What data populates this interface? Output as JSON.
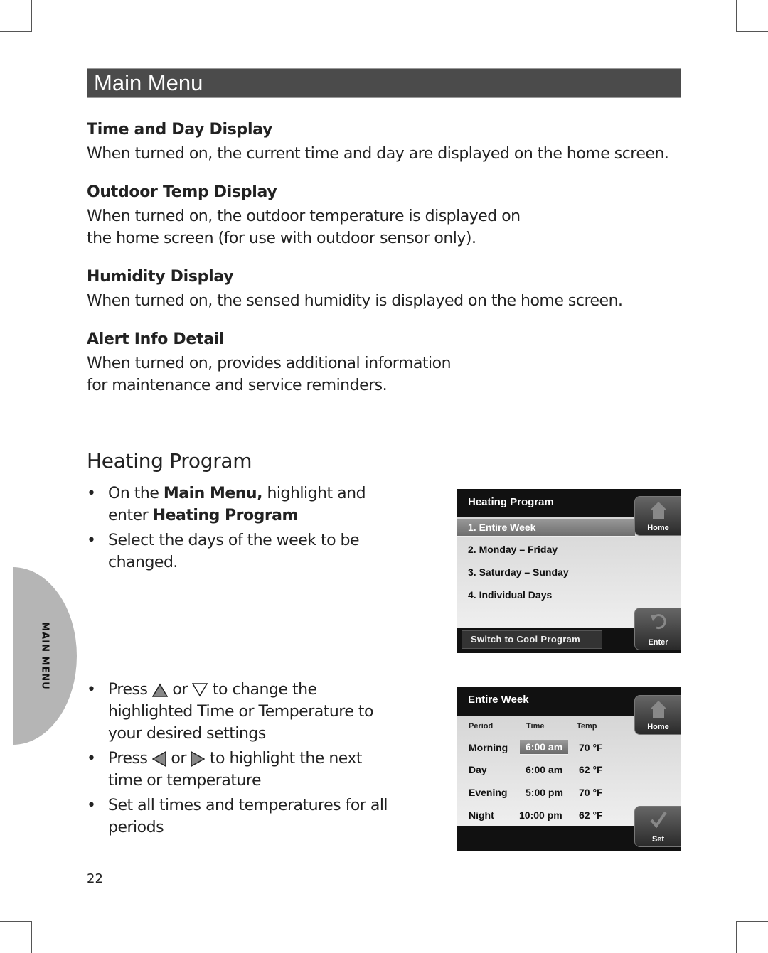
{
  "section_header": "Main Menu",
  "items": [
    {
      "title": "Time and Day Display",
      "text": "When turned on, the current time and day are displayed on the home screen."
    },
    {
      "title": "Outdoor Temp Display",
      "text_lines": [
        "When turned on, the outdoor temperature is displayed on",
        "the home screen (for use with outdoor sensor only)."
      ]
    },
    {
      "title": "Humidity Display",
      "text": "When turned on, the sensed humidity is displayed on the home screen."
    },
    {
      "title": "Alert Info Detail",
      "text_lines": [
        "When turned on, provides additional information",
        "for maintenance and service reminders."
      ]
    }
  ],
  "heating": {
    "title": "Heating Program",
    "bullets1": {
      "b1_pre": "On the ",
      "b1_bold1": "Main Menu,",
      "b1_mid": " highlight and enter ",
      "b1_bold2": "Heating Program",
      "b2": "Select the days of the week to be changed."
    },
    "bullets2": {
      "b1_pre": "Press",
      "b1_or": "or",
      "b1_post": "to change the highlighted Time or Temperature to your desired settings",
      "b2_pre": "Press",
      "b2_or": "or",
      "b2_post": "to highlight the next time or temperature",
      "b3": "Set all times and temperatures for all periods"
    }
  },
  "side_tab": "MAIN MENU",
  "screen1": {
    "title": "Heating Program",
    "options": [
      "1.  Entire Week",
      "2.  Monday – Friday",
      "3.  Saturday – Sunday",
      "4.  Individual Days"
    ],
    "selected_index": 0,
    "switch_button": "Switch to Cool Program",
    "home_button": "Home",
    "enter_button": "Enter"
  },
  "screen2": {
    "title": "Entire Week",
    "columns": [
      "Period",
      "Time",
      "Temp"
    ],
    "rows": [
      {
        "period": "Morning",
        "time": "6:00 am",
        "temp": "70 °F"
      },
      {
        "period": "Day",
        "time": "6:00 am",
        "temp": "62 °F"
      },
      {
        "period": "Evening",
        "time": "5:00 pm",
        "temp": "70 °F"
      },
      {
        "period": "Night",
        "time": "10:00 pm",
        "temp": "62 °F"
      }
    ],
    "highlighted": "Morning time",
    "home_button": "Home",
    "set_button": "Set"
  },
  "bullet_char": "•",
  "page_number": "22"
}
